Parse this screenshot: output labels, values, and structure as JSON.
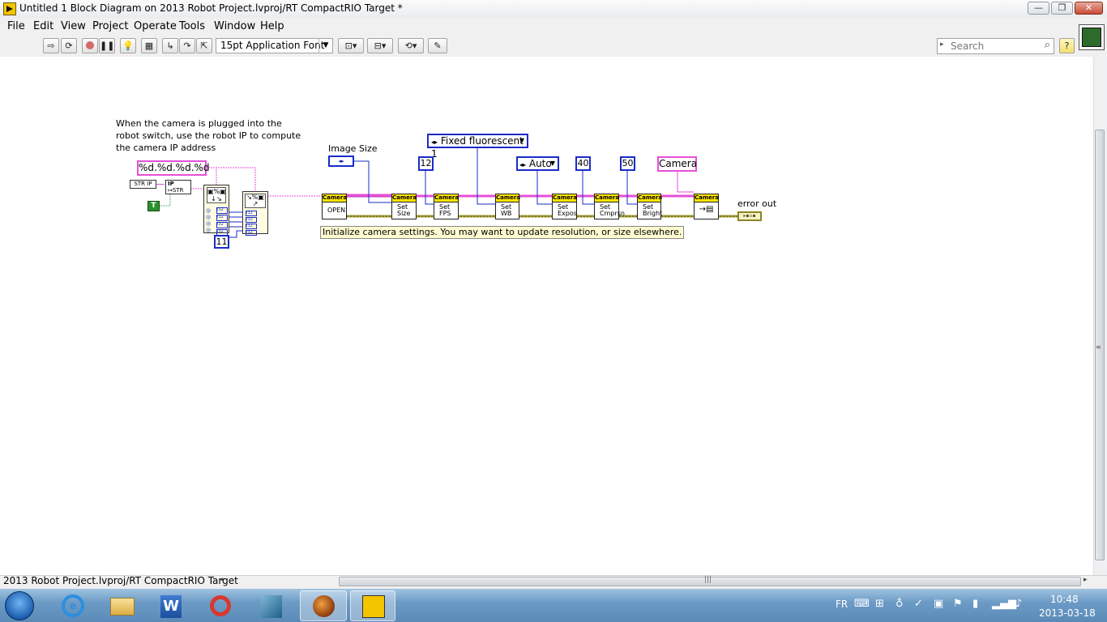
{
  "window": {
    "title": "Untitled 1 Block Diagram on 2013 Robot Project.lvproj/RT CompactRIO Target *",
    "minimize_label": "—",
    "restore_label": "❐",
    "close_label": "✕"
  },
  "menu": [
    "File",
    "Edit",
    "View",
    "Project",
    "Operate",
    "Tools",
    "Window",
    "Help"
  ],
  "toolbar": {
    "font": "15pt Application Font",
    "search_placeholder": "Search"
  },
  "diagram": {
    "comment": [
      "When the camera is plugged into the",
      "robot switch, use the robot IP to compute",
      "the camera IP address"
    ],
    "format_string": "%d.%d.%d.%d",
    "str_ip": "STR IP",
    "true_const": "T",
    "const_11": "11",
    "image_size_label": "Image Size",
    "white_balance": "Fixed fluorescent 1",
    "fps": "12",
    "exposure": "Auto",
    "compression": "40",
    "brightness": "50",
    "camera_name": "Camera",
    "error_out_label": "error out",
    "init_note": "Initialize camera settings. You may want to update resolution, or size elsewhere.",
    "vi_header": "Camera",
    "vis": [
      "OPEN",
      "Set Size",
      "Set FPS",
      "Set WB",
      "Set Expos",
      "Set Cmprsn",
      "Set Bright"
    ]
  },
  "status": {
    "target": "2013 Robot Project.lvproj/RT CompactRIO Target"
  },
  "taskbar": {
    "language": "FR",
    "time": "10:48",
    "date": "2013-03-18"
  },
  "colors": {
    "string_wire": "#e64fd9",
    "int_wire": "#1a2bc9",
    "error_wire": "#b9b13a",
    "vi_header": "#ffe600"
  }
}
